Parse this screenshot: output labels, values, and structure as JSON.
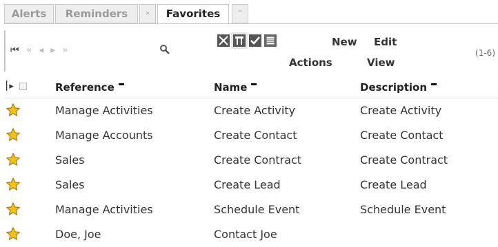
{
  "tabs": {
    "alerts": "Alerts",
    "reminders": "Reminders",
    "more": "»",
    "favorites": "Favorites",
    "collapse": "^"
  },
  "toolbar": {
    "new_actions_line1": "New",
    "new_actions_line2": "Actions",
    "edit_view_line1": "Edit",
    "edit_view_line2": "View",
    "count": "(1-6)"
  },
  "grid": {
    "columns": [
      "Reference",
      "Name",
      "Description"
    ],
    "rows": [
      {
        "reference": "Manage Activities",
        "name": "Create Activity",
        "description": "Create Activity"
      },
      {
        "reference": "Manage Accounts",
        "name": "Create Contact",
        "description": "Create Contact"
      },
      {
        "reference": "Sales",
        "name": "Create Contract",
        "description": "Create Contract"
      },
      {
        "reference": "Sales",
        "name": "Create Lead",
        "description": "Create Lead"
      },
      {
        "reference": "Manage Activities",
        "name": "Schedule Event",
        "description": "Schedule Event"
      },
      {
        "reference": "Doe, Joe",
        "name": "Contact Joe",
        "description": ""
      }
    ]
  },
  "colors": {
    "star_fill": "#f2c21b",
    "star_stroke": "#a87d10"
  }
}
